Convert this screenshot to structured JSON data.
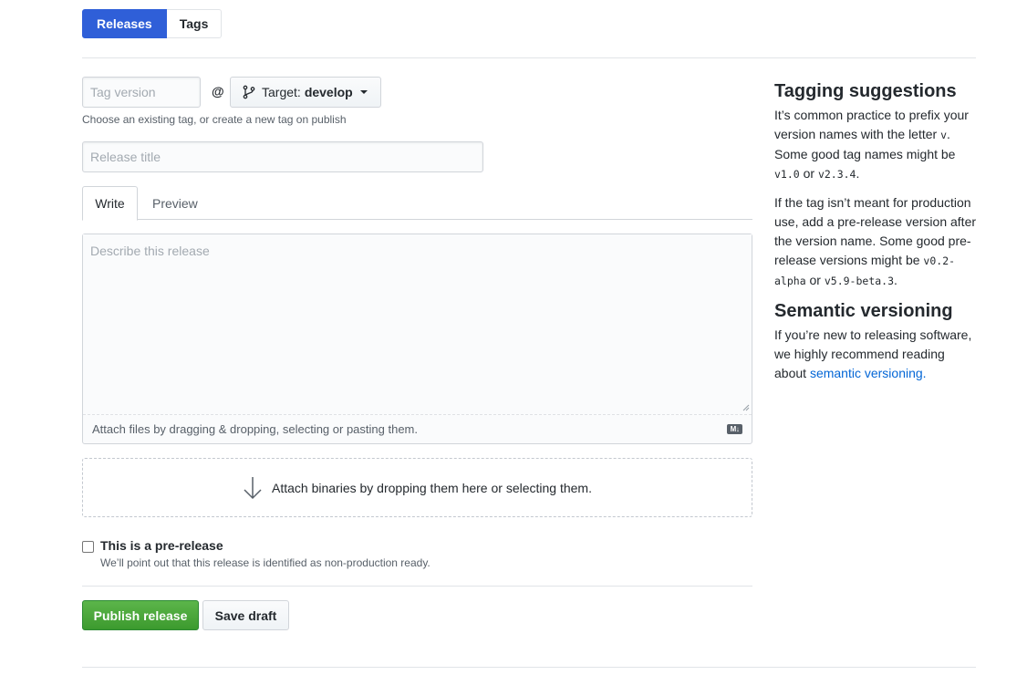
{
  "subnav": {
    "releases_label": "Releases",
    "tags_label": "Tags"
  },
  "form": {
    "tag_placeholder": "Tag version",
    "at_sign": "@",
    "target_label": "Target:",
    "target_value": "develop",
    "tag_hint": "Choose an existing tag, or create a new tag on publish",
    "title_placeholder": "Release title",
    "tabs": {
      "write": "Write",
      "preview": "Preview"
    },
    "body_placeholder": "Describe this release",
    "attach_files_text": "Attach files by dragging & dropping, selecting or pasting them.",
    "markdown_badge": "M↓",
    "binaries_text": "Attach binaries by dropping them here or selecting them.",
    "prerelease_label": "This is a pre-release",
    "prerelease_note": "We’ll point out that this release is identified as non-production ready.",
    "prerelease_checked": false,
    "publish_label": "Publish release",
    "draft_label": "Save draft"
  },
  "aside": {
    "tagging_title": "Tagging suggestions",
    "tagging_p1_a": "It’s common practice to prefix your version names with the letter ",
    "tagging_p1_code1": "v",
    "tagging_p1_b": ". Some good tag names might be ",
    "tagging_p1_code2": "v1.0",
    "tagging_p1_c": " or ",
    "tagging_p1_code3": "v2.3.4",
    "tagging_p1_d": ".",
    "tagging_p2_a": "If the tag isn’t meant for production use, add a pre-release version after the version name. Some good pre-release versions might be ",
    "tagging_p2_code1": "v0.2-alpha",
    "tagging_p2_b": " or ",
    "tagging_p2_code2": "v5.9-beta.3",
    "tagging_p2_c": ".",
    "semver_title": "Semantic versioning",
    "semver_p_a": "If you’re new to releasing software, we highly recommend reading about ",
    "semver_link": "semantic versioning."
  },
  "colors": {
    "accent": "#2f5fd8",
    "publish": "#4aa83c",
    "link": "#0366d6"
  }
}
